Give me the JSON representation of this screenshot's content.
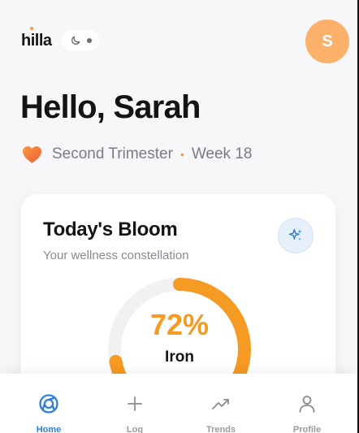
{
  "header": {
    "logo_text": "hilla",
    "avatar_initial": "S"
  },
  "greeting": "Hello, Sarah",
  "status": {
    "trimester": "Second Trimester",
    "separator": "•",
    "week": "Week 18"
  },
  "bloom_card": {
    "title": "Today's Bloom",
    "subtitle": "Your wellness constellation",
    "ring_value": "72%",
    "ring_label": "Iron",
    "progress": 0.72
  },
  "bottom_nav": {
    "items": [
      {
        "label": "Home",
        "icon": "home-icon",
        "active": true
      },
      {
        "label": "Log",
        "icon": "plus-icon",
        "active": false
      },
      {
        "label": "Trends",
        "icon": "trend-icon",
        "active": false
      },
      {
        "label": "Profile",
        "icon": "user-icon",
        "active": false
      }
    ]
  },
  "colors": {
    "accent": "#f59a22",
    "active_nav": "#2f7fd8",
    "avatar": "#fbb16a",
    "background": "#f7f7f9"
  }
}
